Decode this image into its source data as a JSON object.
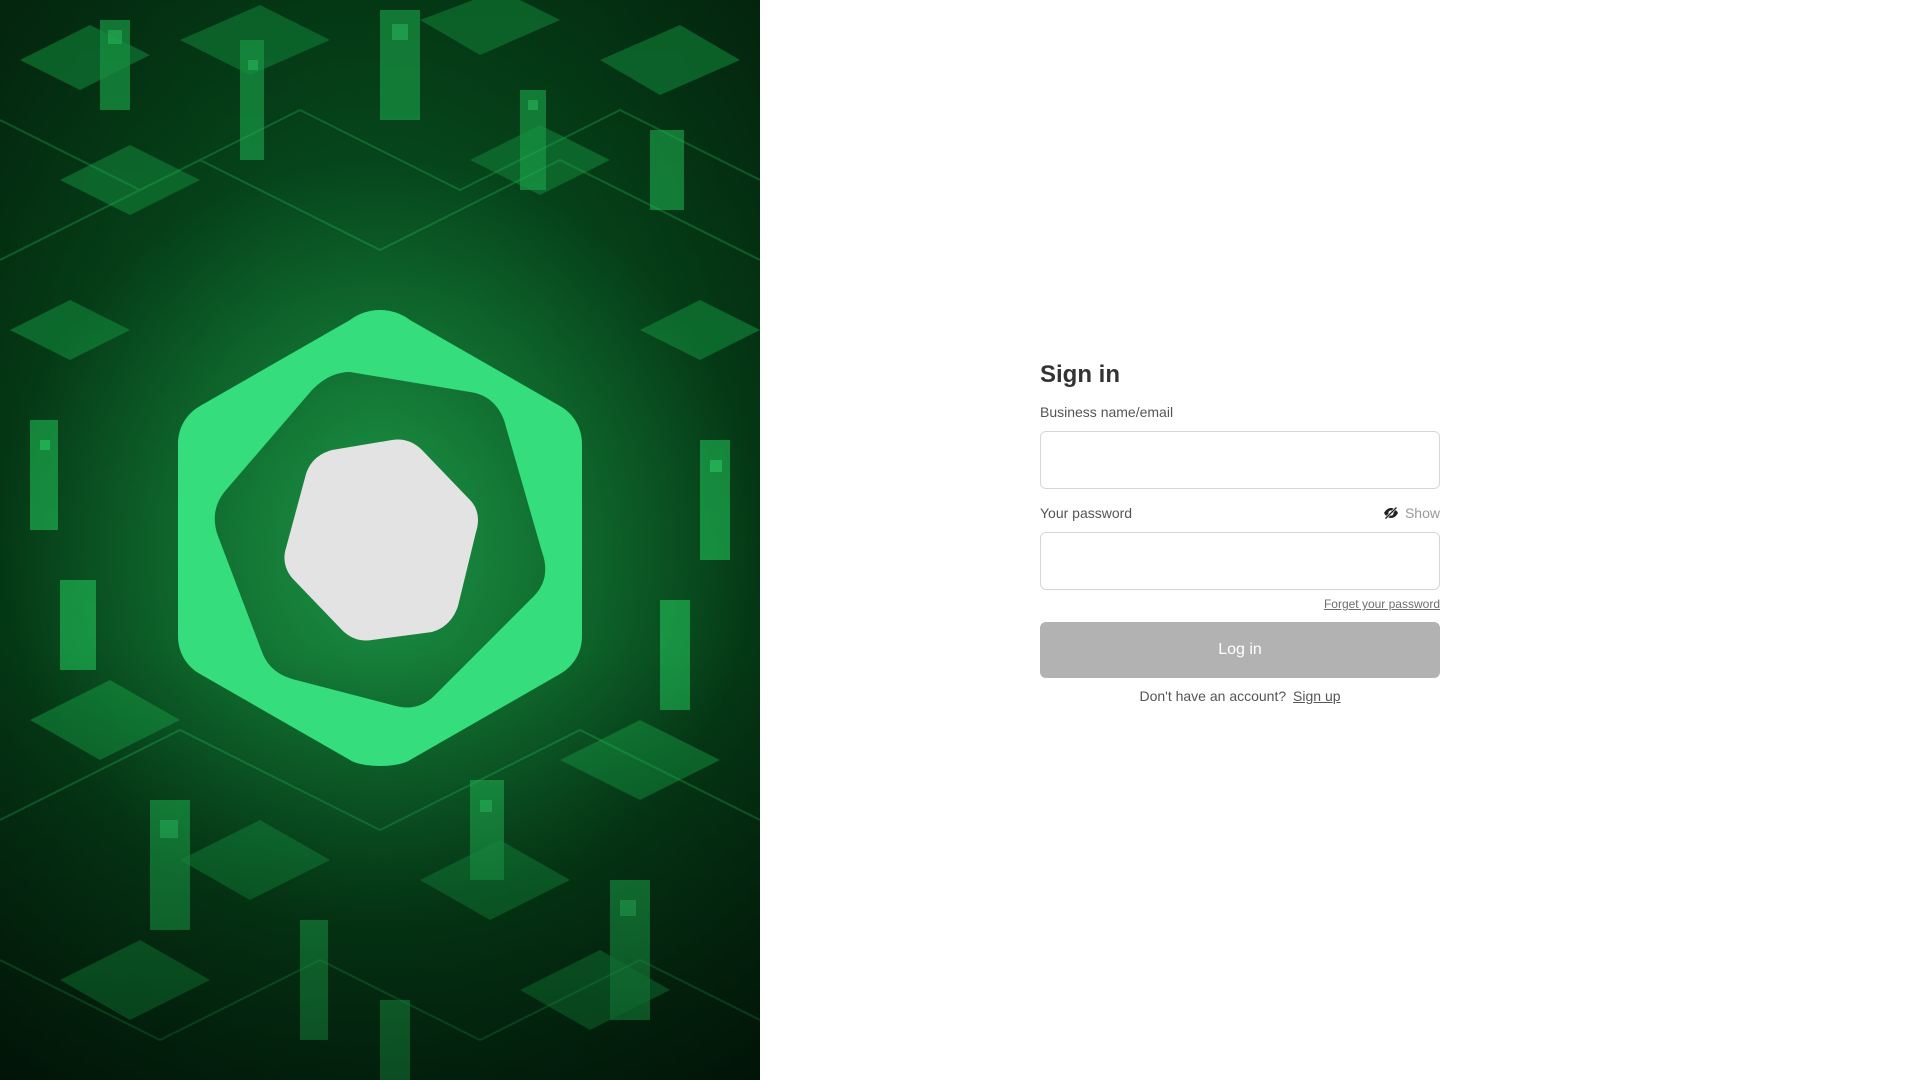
{
  "hero": {
    "background_color": "#064a1c",
    "logo_color": "#35dd7c",
    "logo_inner_color": "#e3e3e3",
    "logo_icon": "hexagon-logo-icon"
  },
  "form": {
    "title": "Sign in",
    "email_label": "Business name/email",
    "email_value": "",
    "password_label": "Your password",
    "password_value": "",
    "show_label": "Show",
    "show_icon": "eye-slash-icon",
    "forgot_label": "Forget your password",
    "login_label": "Log in",
    "login_disabled_color": "#b2b2b2",
    "signup_prompt": "Don't have an account?",
    "signup_label": "Sign up"
  }
}
